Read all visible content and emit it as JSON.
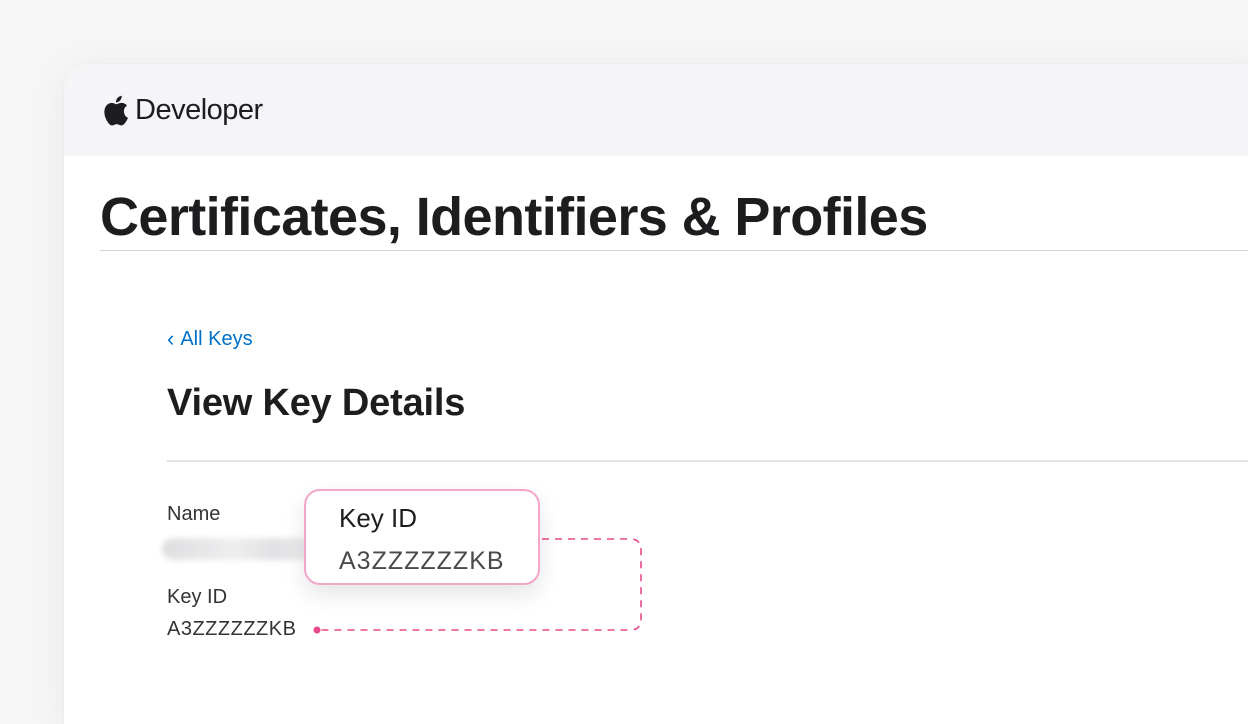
{
  "header": {
    "brand_text": "Developer",
    "logo_icon": "apple-logo"
  },
  "page": {
    "title": "Certificates, Identifiers & Profiles"
  },
  "breadcrumb": {
    "back_icon": "chevron-left-icon",
    "back_label": "All Keys"
  },
  "section": {
    "title": "View Key Details"
  },
  "fields": {
    "name_label": "Name",
    "key_id_label": "Key ID",
    "key_id_value": "A3ZZZZZZKB"
  },
  "callout": {
    "title": "Key ID",
    "value": "A3ZZZZZZKB",
    "accent_color": "#e8498a"
  },
  "colors": {
    "link": "#0070c9",
    "text": "#1d1d1f",
    "highlight": "#e8498a"
  }
}
